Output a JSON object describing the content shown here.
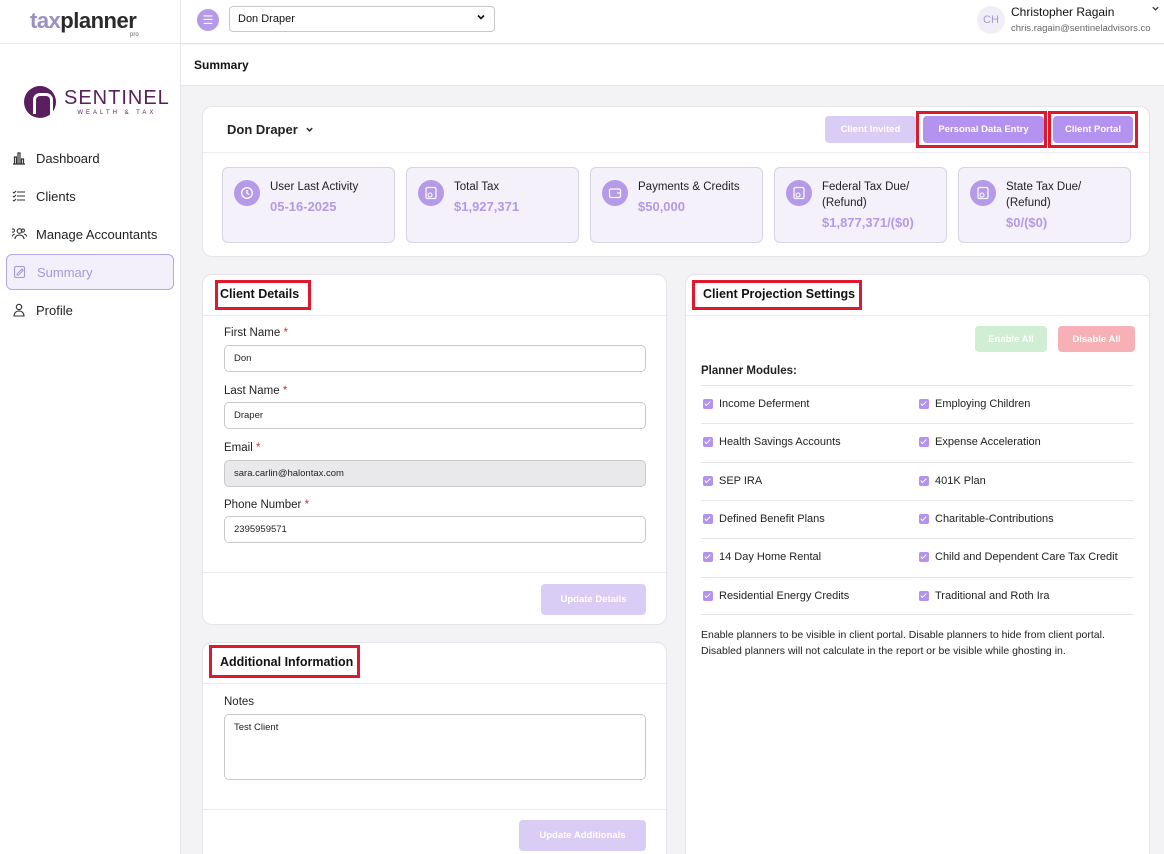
{
  "app": {
    "logo_tax": "tax",
    "logo_planner": "planner",
    "logo_sub": "pro"
  },
  "brand": {
    "name": "SENTINEL",
    "tagline": "WEALTH & TAX"
  },
  "sidebar": {
    "items": [
      {
        "label": "Dashboard",
        "icon": "bar-chart-icon"
      },
      {
        "label": "Clients",
        "icon": "list-icon"
      },
      {
        "label": "Manage Accountants",
        "icon": "users-icon"
      },
      {
        "label": "Summary",
        "icon": "edit-doc-icon",
        "active": true
      },
      {
        "label": "Profile",
        "icon": "user-icon"
      }
    ]
  },
  "topbar": {
    "client_select": "Don Draper",
    "avatar_initials": "CH",
    "user_name": "Christopher Ragain",
    "user_email": "chris.ragain@sentineladvisors.co"
  },
  "page": {
    "title": "Summary"
  },
  "summary": {
    "client_name": "Don Draper",
    "buttons": {
      "invited": "Client Invited",
      "personal": "Personal Data Entry",
      "portal": "Client Portal"
    },
    "stats": [
      {
        "label": "User Last Activity",
        "value": "05-16-2025"
      },
      {
        "label": "Total Tax",
        "value": "$1,927,371"
      },
      {
        "label": "Payments & Credits",
        "value": "$50,000"
      },
      {
        "label": "Federal Tax Due/\n(Refund)",
        "label1": "Federal Tax Due/",
        "label2": "(Refund)",
        "value": "$1,877,371/($0)"
      },
      {
        "label": "State Tax Due/\n(Refund)",
        "label1": "State Tax Due/",
        "label2": "(Refund)",
        "value": "$0/($0)"
      }
    ]
  },
  "client_details": {
    "title": "Client Details",
    "first_name_label": "First Name",
    "first_name": "Don",
    "last_name_label": "Last Name",
    "last_name": "Draper",
    "email_label": "Email",
    "email": "sara.carlin@halontax.com",
    "phone_label": "Phone Number",
    "phone": "2395959571",
    "required_mark": "*",
    "update_button": "Update Details"
  },
  "additional": {
    "title": "Additional Information",
    "notes_label": "Notes",
    "notes": "Test Client",
    "update_button": "Update Additionals"
  },
  "projection": {
    "title": "Client Projection Settings",
    "enable_all": "Enable All",
    "disable_all": "Disable All",
    "modules_title": "Planner Modules:",
    "rows": [
      [
        "Income Deferment",
        "Employing Children"
      ],
      [
        "Health Savings Accounts",
        "Expense Acceleration"
      ],
      [
        "SEP IRA",
        "401K Plan"
      ],
      [
        "Defined Benefit Plans",
        "Charitable-Contributions"
      ],
      [
        "14 Day Home Rental",
        "Child and Dependent Care Tax Credit"
      ],
      [
        "Residential Energy Credits",
        "Traditional and Roth Ira"
      ]
    ],
    "note": "Enable planners to be visible in client portal. Disable planners to hide from client portal. Disabled planners will not calculate in the report or be visible while ghosting in."
  },
  "colors": {
    "accent": "#b493f0",
    "highlight": "#e0182d",
    "brand": "#5a1f5e"
  }
}
